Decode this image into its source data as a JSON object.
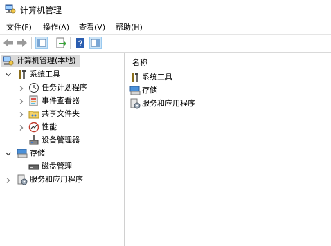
{
  "window": {
    "title": "计算机管理"
  },
  "menu": [
    {
      "label": "文件(F)"
    },
    {
      "label": "操作(A)"
    },
    {
      "label": "查看(V)"
    },
    {
      "label": "帮助(H)"
    }
  ],
  "toolbar": {
    "buttons": [
      {
        "icon": "back-arrow-icon"
      },
      {
        "icon": "forward-arrow-icon"
      },
      {
        "icon": "show-hide-console-tree-icon"
      },
      {
        "icon": "export-list-icon"
      },
      {
        "icon": "help-icon"
      },
      {
        "icon": "show-action-pane-icon"
      }
    ]
  },
  "tree": {
    "root": "计算机管理(本地)",
    "system_tools": "系统工具",
    "task_scheduler": "任务计划程序",
    "event_viewer": "事件查看器",
    "shared_folders": "共享文件夹",
    "performance": "性能",
    "device_manager": "设备管理器",
    "storage": "存储",
    "disk_management": "磁盘管理",
    "services_apps": "服务和应用程序"
  },
  "list": {
    "column_name": "名称",
    "items": [
      {
        "label": "系统工具",
        "icon": "tools-icon"
      },
      {
        "label": "存储",
        "icon": "storage-icon"
      },
      {
        "label": "服务和应用程序",
        "icon": "services-icon"
      }
    ]
  }
}
